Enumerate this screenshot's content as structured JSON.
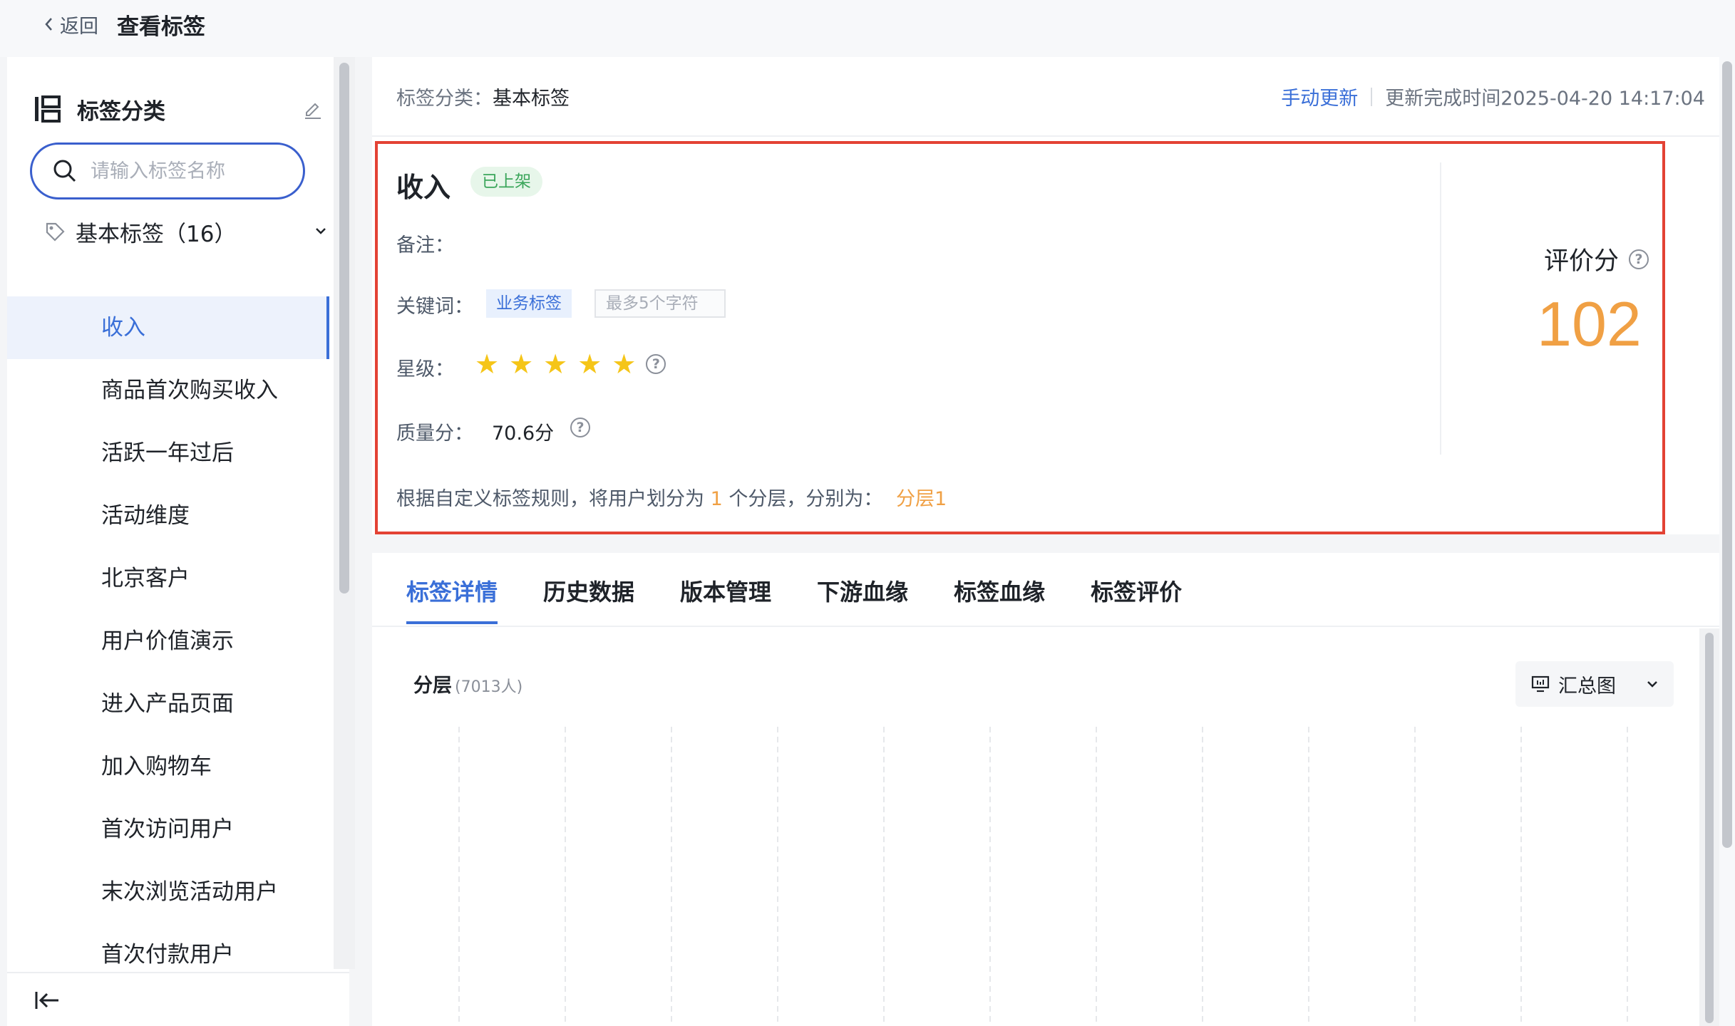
{
  "header": {
    "back_label": "返回",
    "title": "查看标签"
  },
  "sidebar": {
    "title": "标签分类",
    "search_placeholder": "请输入标签名称",
    "group_label": "基本标签（16）",
    "items": [
      {
        "label": "收入",
        "active": true
      },
      {
        "label": "商品首次购买收入"
      },
      {
        "label": "活跃一年过后"
      },
      {
        "label": "活动维度"
      },
      {
        "label": "北京客户"
      },
      {
        "label": "用户价值演示"
      },
      {
        "label": "进入产品页面"
      },
      {
        "label": "加入购物车"
      },
      {
        "label": "首次访问用户"
      },
      {
        "label": "末次浏览活动用户"
      },
      {
        "label": "首次付款用户"
      }
    ]
  },
  "info": {
    "category_label": "标签分类：",
    "category_value": "基本标签",
    "manual_update": "手动更新",
    "update_time": "更新完成时间2025-04-20 14:17:04",
    "tag_name": "收入",
    "status": "已上架",
    "remark_label": "备注：",
    "keyword_label": "关键词：",
    "keyword_chip": "业务标签",
    "keyword_placeholder": "最多5个字符",
    "star_label": "星级：",
    "stars": 5,
    "star_glyph": "★",
    "quality_label": "质量分：",
    "quality_value": "70.6分",
    "rule_prefix": "根据自定义标签规则，将用户划分为",
    "rule_count": "1",
    "rule_suffix": "个分层，分别为：",
    "rule_layer": "分层1",
    "score_label": "评价分",
    "score_value": "102",
    "help_glyph": "?"
  },
  "tabs": [
    {
      "label": "标签详情",
      "active": true
    },
    {
      "label": "历史数据"
    },
    {
      "label": "版本管理"
    },
    {
      "label": "下游血缘"
    },
    {
      "label": "标签血缘"
    },
    {
      "label": "标签评价"
    }
  ],
  "chart": {
    "title": "分层",
    "count": "(7013人)",
    "view_label": "汇总图"
  },
  "colors": {
    "accent": "#3a6fd8",
    "highlight": "#e34234",
    "score": "#f0a044",
    "status_green": "#3aa55a"
  }
}
